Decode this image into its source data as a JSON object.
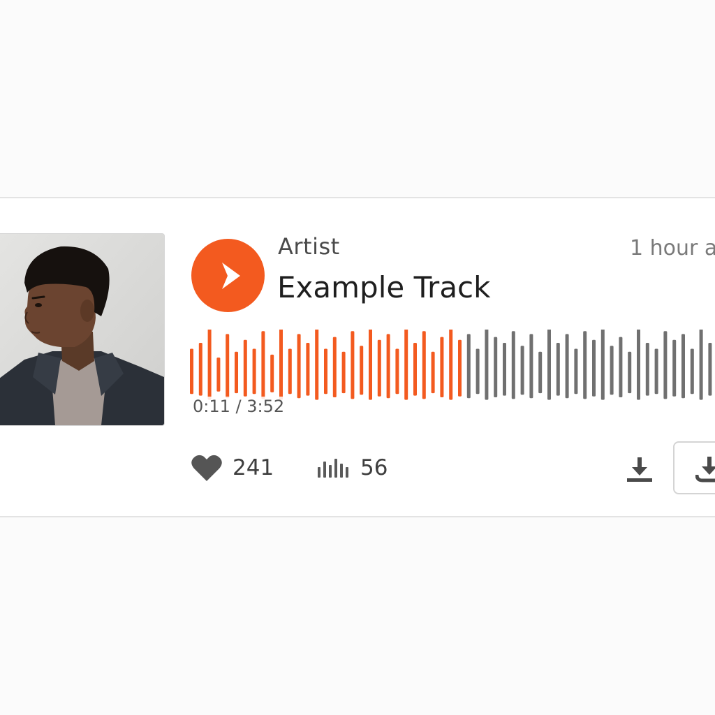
{
  "track": {
    "artist": "Artist",
    "title": "Example Track",
    "posted": "1 hour a",
    "time_display": "0:11 / 3:52",
    "progress": 0.53,
    "likes": "241",
    "plays": "56"
  },
  "colors": {
    "accent": "#f35a1f",
    "waveform_played": "#f35a1f",
    "waveform_unplayed": "#707070"
  },
  "icons": {
    "play": "play-icon",
    "like": "heart-icon",
    "plays": "bar-chart-icon",
    "download": "download-icon"
  }
}
